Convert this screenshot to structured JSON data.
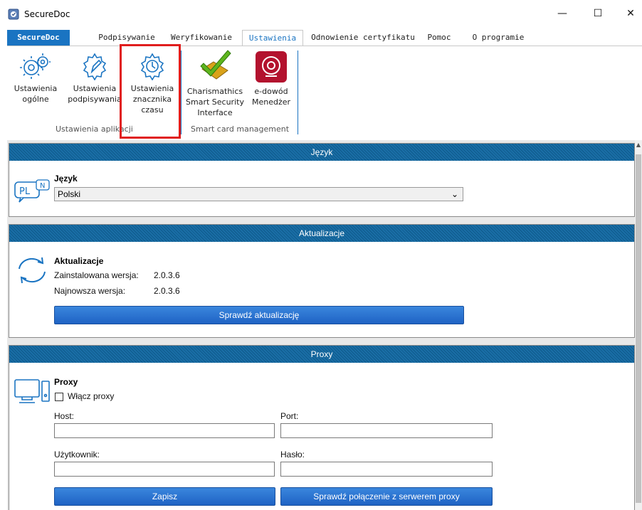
{
  "window": {
    "title": "SecureDoc",
    "minimize": "—",
    "maximize": "☐",
    "close": "✕"
  },
  "tabs": [
    {
      "label": "SecureDoc"
    },
    {
      "label": "Podpisywanie"
    },
    {
      "label": "Weryfikowanie"
    },
    {
      "label": "Ustawienia"
    },
    {
      "label": "Odnowienie certyfikatu"
    },
    {
      "label": "Pomoc"
    },
    {
      "label": "O programie"
    }
  ],
  "ribbon": {
    "general": {
      "line1": "Ustawienia",
      "line2": "ogólne"
    },
    "signing": {
      "line1": "Ustawienia",
      "line2": "podpisywania"
    },
    "timestamp": {
      "line1": "Ustawienia",
      "line2": "znacznika",
      "line3": "czasu"
    },
    "charismathics": {
      "line1": "Charismathics",
      "line2": "Smart Security",
      "line3": "Interface"
    },
    "edowod": {
      "line1": "e-dowód",
      "line2": "Menedżer"
    },
    "group_app": "Ustawienia aplikacji",
    "group_smartcard": "Smart card management"
  },
  "language": {
    "header": "Język",
    "title": "Język",
    "icon_text": "PL",
    "icon_text2": "N",
    "selected": "Polski"
  },
  "updates": {
    "header": "Aktualizacje",
    "title": "Aktualizacje",
    "installed_label": "Zainstalowana wersja:",
    "installed_value": "2.0.3.6",
    "latest_label": "Najnowsza wersja:",
    "latest_value": "2.0.3.6",
    "check_button": "Sprawdź aktualizację"
  },
  "proxy": {
    "header": "Proxy",
    "title": "Proxy",
    "enable_label": "Włącz proxy",
    "enabled": false,
    "host_label": "Host:",
    "host_value": "",
    "port_label": "Port:",
    "port_value": "",
    "user_label": "Użytkownik:",
    "user_value": "",
    "password_label": "Hasło:",
    "password_value": "",
    "save_button": "Zapisz",
    "test_button": "Sprawdź połączenie z serwerem proxy"
  },
  "colors": {
    "accent": "#1a74c2",
    "header_bg": "#0e5a8c",
    "highlight": "#e01d1d",
    "button": "#2a74d2"
  }
}
